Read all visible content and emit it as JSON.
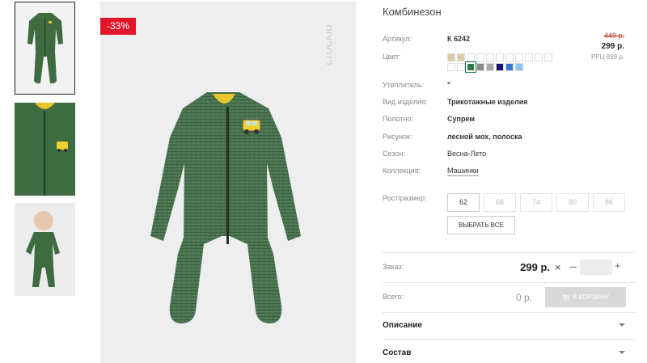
{
  "product": {
    "title": "Комбинезон",
    "discount_badge": "-33%",
    "old_price": "449 р.",
    "new_price": "299 р.",
    "rrp": "РРЦ 899 р."
  },
  "brand": {
    "logo_text": "crockid"
  },
  "attributes": {
    "article_label": "Артикул:",
    "article_value": "К 6242",
    "color_label": "Цвет:",
    "insulation_label": "Утеплитель:",
    "insulation_value": "\"",
    "type_label": "Вид изделия:",
    "type_value": "Трикотажные изделия",
    "fabric_label": "Полотно:",
    "fabric_value": "Супрем",
    "pattern_label": "Рисунок:",
    "pattern_value": "лесной мох, полоска",
    "season_label": "Сезон:",
    "season_value": "Весна-Лето",
    "collection_label": "Коллекция:",
    "collection_value": "Машинки"
  },
  "colors": [
    "#d9ccaa",
    "#d9ccaa",
    "#ffffff",
    "#ffffff",
    "#ffffff",
    "#ffffff",
    "#ffffff",
    "#ffffff",
    "#ffffff",
    "#ffffff",
    "#ffffff",
    "#ffffff",
    "#ffffff",
    "#2f7a4c",
    "#8a8a8a",
    "#a8a8a8",
    "#12136e",
    "#3a73d1",
    "#8cc4ef"
  ],
  "selected_color": "#2f7a4c",
  "sizes": {
    "label": "Рост/размер:",
    "options": [
      "62",
      "68",
      "74",
      "80",
      "86"
    ],
    "available": [
      "62"
    ],
    "select_all": "ВЫБРАТЬ ВСЕ"
  },
  "order": {
    "label": "Заказ:",
    "price": "299 р.",
    "remove": "×",
    "minus": "–",
    "plus": "+",
    "quantity": ""
  },
  "total": {
    "label": "Всего:",
    "value": "0 р.",
    "cart_button": "В КОРЗИНУ"
  },
  "accordion": [
    "Описание",
    "Состав"
  ]
}
